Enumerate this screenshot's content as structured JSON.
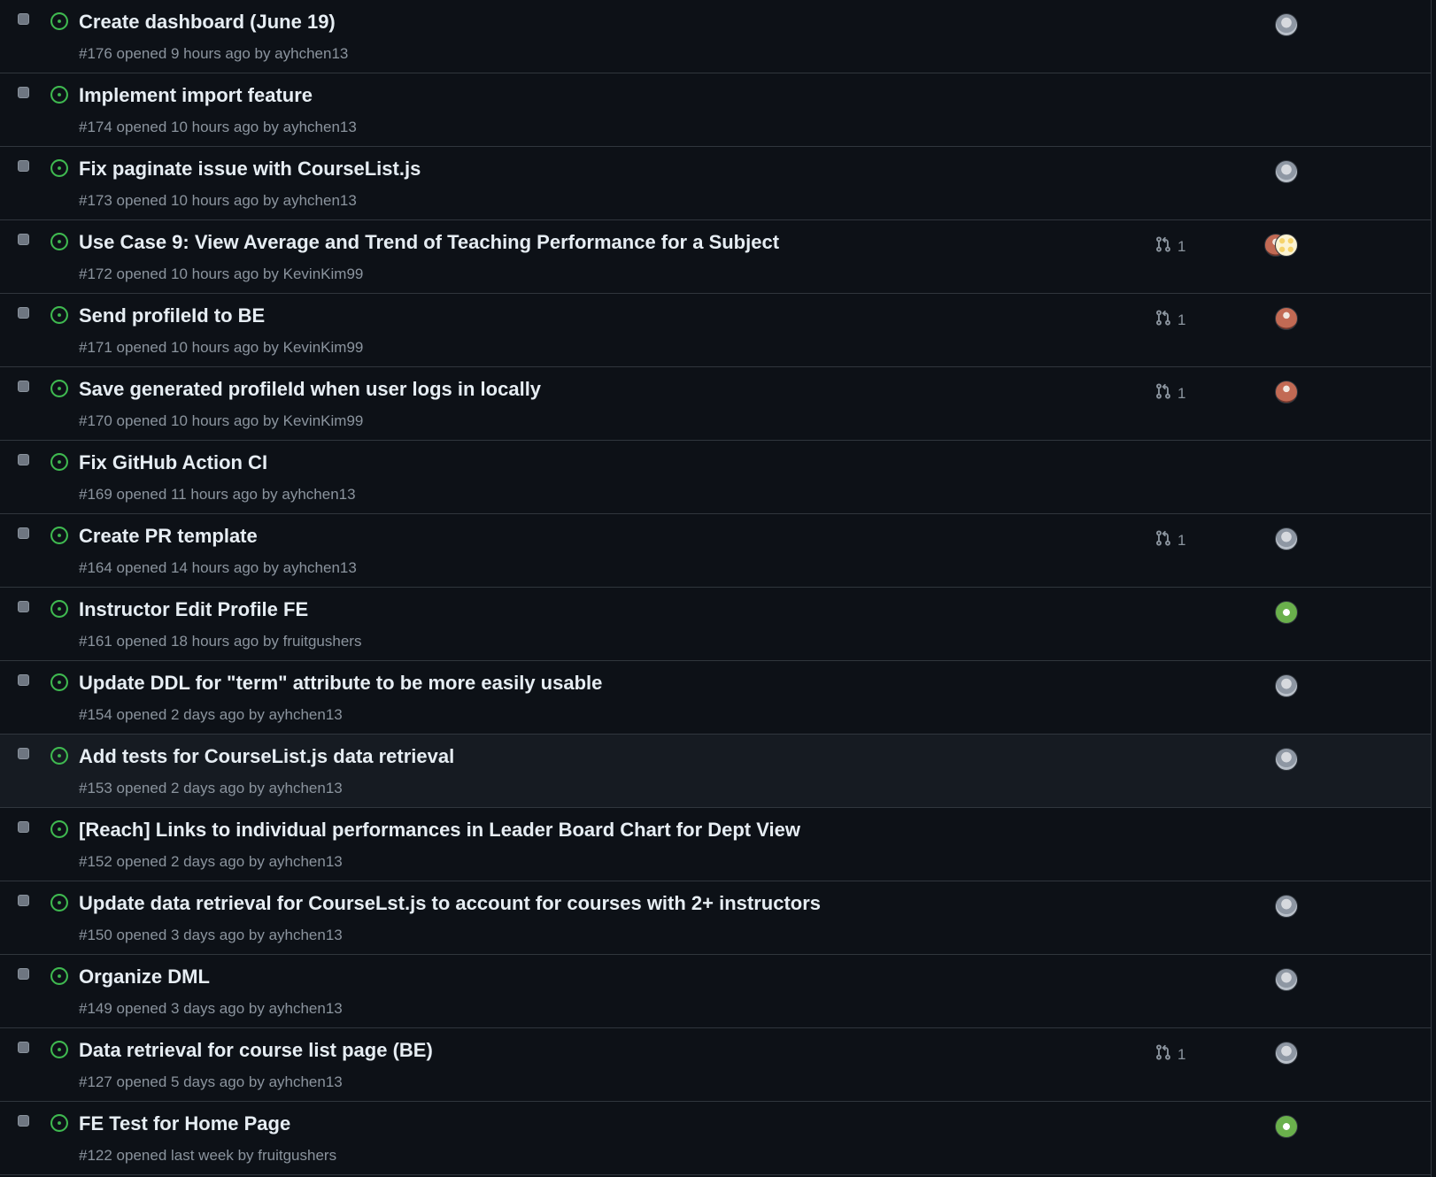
{
  "colors": {
    "background": "#0d1117",
    "border": "#30363d",
    "open_icon": "#3fb950",
    "title_text": "#e6edf3",
    "meta_text": "#8b949e"
  },
  "icons": {
    "state": "issue-opened-icon",
    "linked_pr": "git-pull-request-icon"
  },
  "issues": [
    {
      "title": "Create dashboard (June 19)",
      "meta": "#176 opened 9 hours ago by ayhchen13",
      "pr_count": "",
      "avatars": [
        "ayh"
      ]
    },
    {
      "title": "Implement import feature",
      "meta": "#174 opened 10 hours ago by ayhchen13",
      "pr_count": "",
      "avatars": []
    },
    {
      "title": "Fix paginate issue with CourseList.js",
      "meta": "#173 opened 10 hours ago by ayhchen13",
      "pr_count": "",
      "avatars": [
        "ayh"
      ]
    },
    {
      "title": "Use Case 9: View Average and Trend of Teaching Performance for a Subject",
      "meta": "#172 opened 10 hours ago by KevinKim99",
      "pr_count": "1",
      "avatars": [
        "kev",
        "ora"
      ]
    },
    {
      "title": "Send profileId to BE",
      "meta": "#171 opened 10 hours ago by KevinKim99",
      "pr_count": "1",
      "avatars": [
        "kev"
      ]
    },
    {
      "title": "Save generated profileId when user logs in locally",
      "meta": "#170 opened 10 hours ago by KevinKim99",
      "pr_count": "1",
      "avatars": [
        "kev"
      ]
    },
    {
      "title": "Fix GitHub Action CI",
      "meta": "#169 opened 11 hours ago by ayhchen13",
      "pr_count": "",
      "avatars": []
    },
    {
      "title": "Create PR template",
      "meta": "#164 opened 14 hours ago by ayhchen13",
      "pr_count": "1",
      "avatars": [
        "ayh"
      ]
    },
    {
      "title": "Instructor Edit Profile FE",
      "meta": "#161 opened 18 hours ago by fruitgushers",
      "pr_count": "",
      "avatars": [
        "fru"
      ]
    },
    {
      "title": "Update DDL for \"term\" attribute to be more easily usable",
      "meta": "#154 opened 2 days ago by ayhchen13",
      "pr_count": "",
      "avatars": [
        "ayh"
      ]
    },
    {
      "title": "Add tests for CourseList.js data retrieval",
      "meta": "#153 opened 2 days ago by ayhchen13",
      "pr_count": "",
      "avatars": [
        "ayh"
      ]
    },
    {
      "title": "[Reach] Links to individual performances in Leader Board Chart for Dept View",
      "meta": "#152 opened 2 days ago by ayhchen13",
      "pr_count": "",
      "avatars": []
    },
    {
      "title": "Update data retrieval for CourseLst.js to account for courses with 2+ instructors",
      "meta": "#150 opened 3 days ago by ayhchen13",
      "pr_count": "",
      "avatars": [
        "ayh"
      ]
    },
    {
      "title": "Organize DML",
      "meta": "#149 opened 3 days ago by ayhchen13",
      "pr_count": "",
      "avatars": [
        "ayh"
      ]
    },
    {
      "title": "Data retrieval for course list page (BE)",
      "meta": "#127 opened 5 days ago by ayhchen13",
      "pr_count": "1",
      "avatars": [
        "ayh"
      ]
    },
    {
      "title": "FE Test for Home Page",
      "meta": "#122 opened last week by fruitgushers",
      "pr_count": "",
      "avatars": [
        "fru"
      ]
    }
  ]
}
